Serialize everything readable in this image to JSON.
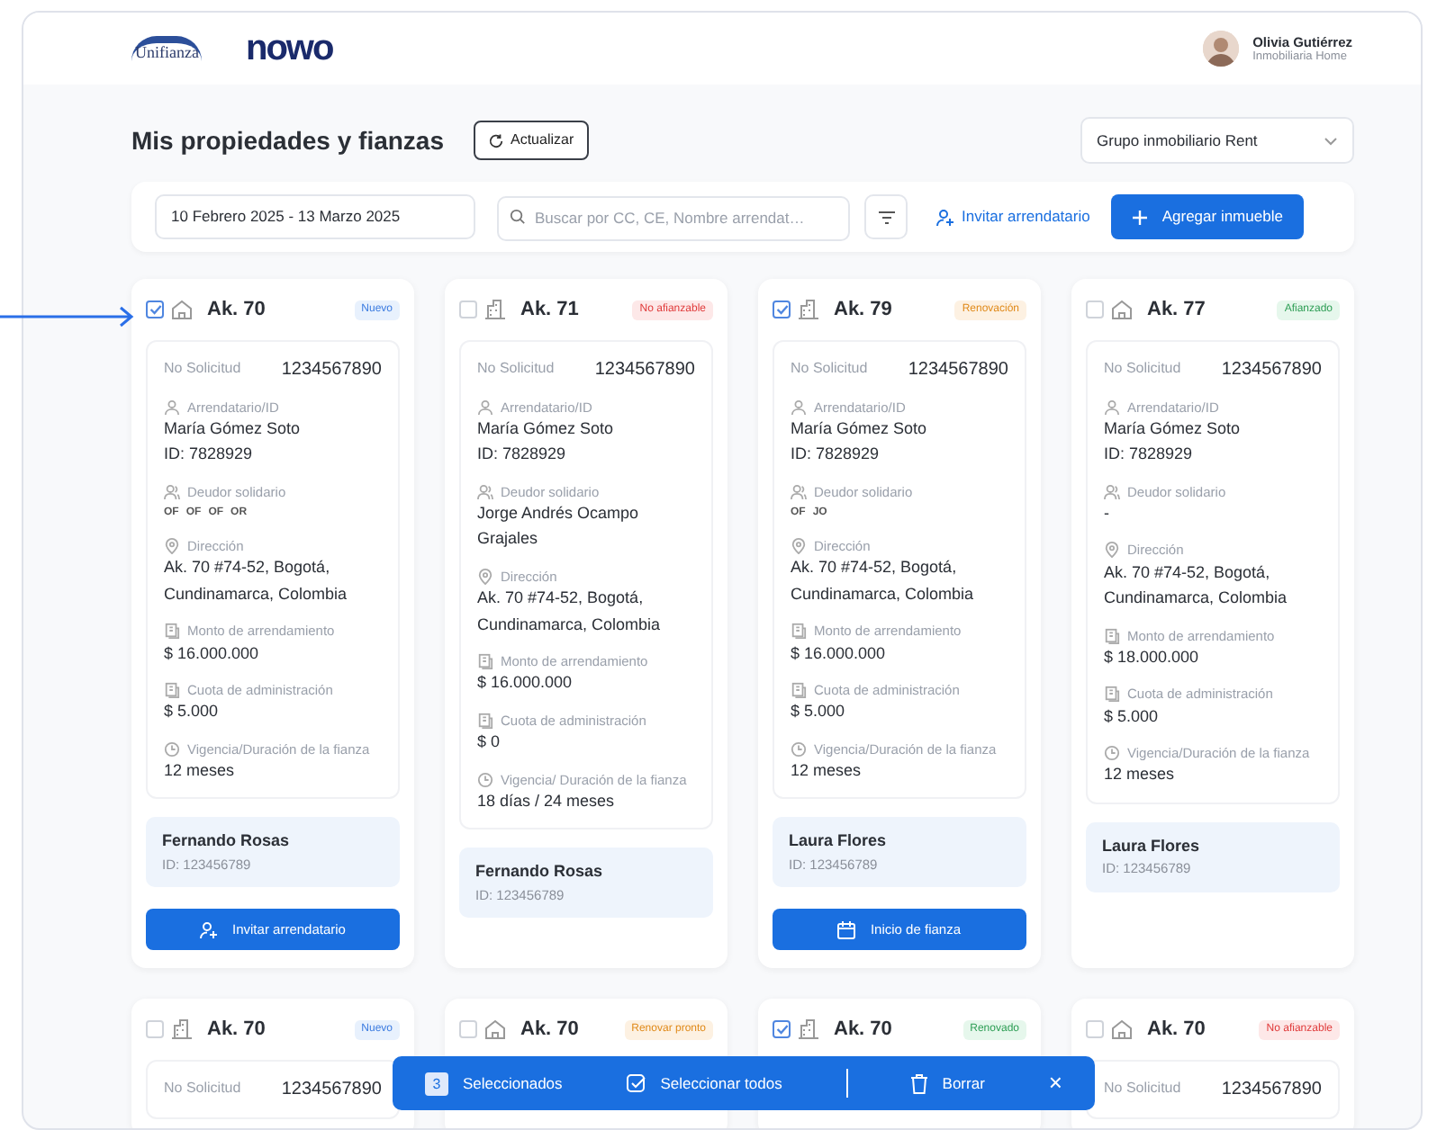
{
  "header": {
    "logos": [
      "Unifianza",
      "nowo"
    ],
    "user": {
      "name": "Olivia Gutiérrez",
      "company": "Inmobiliaria Home"
    }
  },
  "title": "Mis propiedades y fianzas",
  "refresh_button": "Actualizar",
  "group_select": {
    "value": "Grupo inmobiliario Rent"
  },
  "toolbar": {
    "date_range": "10 Febrero 2025 - 13 Marzo 2025",
    "search": {
      "placeholder": "Buscar por CC, CE, Nombre arrendat…"
    },
    "invite_link": "Invitar arrendatario",
    "add_button": "Agregar inmueble"
  },
  "cards": [
    {
      "checked": true,
      "kind": "house",
      "title": "Ak. 70",
      "status": {
        "kind": "new",
        "label": "Nuevo"
      },
      "request": {
        "label": "No Solicitud",
        "value": "1234567890"
      },
      "fields": [
        {
          "kind": "person",
          "label": "Arrendatario/ID",
          "lines": [
            "María Gómez Soto",
            "ID: 7828929"
          ]
        },
        {
          "kind": "group",
          "label": "Deudor solidario",
          "chips": [
            "OF",
            "OF",
            "OF",
            "OR"
          ]
        },
        {
          "kind": "pin",
          "label": "Dirección",
          "lines": [
            "Ak. 70 #74-52, Bogotá, Cundinamarca, Colombia"
          ]
        },
        {
          "kind": "doc",
          "label": "Monto de arrendamiento",
          "lines": [
            "$ 16.000.000"
          ]
        },
        {
          "kind": "doc",
          "label": "Cuota de administración",
          "lines": [
            "$ 5.000"
          ]
        },
        {
          "kind": "clock",
          "label": "Vigencia/Duración de la fianza",
          "lines": [
            "12 meses"
          ]
        }
      ],
      "tenant": {
        "name": "Fernando Rosas",
        "id": "ID: 123456789"
      },
      "action": {
        "kind": "invite",
        "label": "Invitar arrendatario"
      }
    },
    {
      "checked": false,
      "kind": "building",
      "title": "Ak. 71",
      "status": {
        "kind": "not_eligible",
        "label": "No afianzable"
      },
      "request": {
        "label": "No Solicitud",
        "value": "1234567890"
      },
      "fields": [
        {
          "kind": "person",
          "label": "Arrendatario/ID",
          "lines": [
            "María Gómez Soto",
            "ID: 7828929"
          ]
        },
        {
          "kind": "group",
          "label": "Deudor solidario",
          "lines": [
            "Jorge Andrés Ocampo Grajales"
          ]
        },
        {
          "kind": "pin",
          "label": "Dirección",
          "lines": [
            "Ak. 70 #74-52, Bogotá, Cundinamarca, Colombia"
          ]
        },
        {
          "kind": "doc",
          "label": "Monto de arrendamiento",
          "lines": [
            "$ 16.000.000"
          ]
        },
        {
          "kind": "doc",
          "label": "Cuota de administración",
          "lines": [
            "$ 0"
          ]
        },
        {
          "kind": "clock",
          "label": "Vigencia/ Duración de la fianza",
          "lines": [
            "18 días / 24 meses"
          ]
        }
      ],
      "tenant": {
        "name": "Fernando Rosas",
        "id": "ID: 123456789"
      }
    },
    {
      "checked": true,
      "kind": "building",
      "title": "Ak. 79",
      "status": {
        "kind": "renewal",
        "label": "Renovación"
      },
      "request": {
        "label": "No Solicitud",
        "value": "1234567890"
      },
      "fields": [
        {
          "kind": "person",
          "label": "Arrendatario/ID",
          "lines": [
            "María Gómez Soto",
            "ID: 7828929"
          ]
        },
        {
          "kind": "group",
          "label": "Deudor solidario",
          "chips": [
            "OF",
            "JO"
          ]
        },
        {
          "kind": "pin",
          "label": "Dirección",
          "lines": [
            "Ak. 70 #74-52, Bogotá, Cundinamarca, Colombia"
          ]
        },
        {
          "kind": "doc",
          "label": "Monto de arrendamiento",
          "lines": [
            "$ 16.000.000"
          ]
        },
        {
          "kind": "doc",
          "label": "Cuota de administración",
          "lines": [
            "$ 5.000"
          ]
        },
        {
          "kind": "clock",
          "label": "Vigencia/Duración de la fianza",
          "lines": [
            "12 meses"
          ]
        }
      ],
      "tenant": {
        "name": "Laura Flores",
        "id": "ID: 123456789"
      },
      "action": {
        "kind": "start",
        "label": "Inicio de fianza"
      }
    },
    {
      "checked": false,
      "kind": "house",
      "title": "Ak. 77",
      "status": {
        "kind": "bonded",
        "label": "Afianzado"
      },
      "request": {
        "label": "No Solicitud",
        "value": "1234567890"
      },
      "fields": [
        {
          "kind": "person",
          "label": "Arrendatario/ID",
          "lines": [
            "María Gómez Soto",
            "ID: 7828929"
          ]
        },
        {
          "kind": "group",
          "label": "Deudor solidario",
          "lines": [
            "-"
          ]
        },
        {
          "kind": "pin",
          "label": "Dirección",
          "lines": [
            "Ak. 70 #74-52, Bogotá, Cundinamarca, Colombia"
          ]
        },
        {
          "kind": "doc",
          "label": "Monto de arrendamiento",
          "lines": [
            "$ 18.000.000"
          ]
        },
        {
          "kind": "doc",
          "label": "Cuota de administración",
          "lines": [
            "$ 5.000"
          ]
        },
        {
          "kind": "clock",
          "label": "Vigencia/Duración de la fianza",
          "lines": [
            "12 meses"
          ]
        }
      ],
      "tenant": {
        "name": "Laura Flores",
        "id": "ID: 123456789"
      }
    },
    {
      "checked": false,
      "kind": "building",
      "title": "Ak. 70",
      "status": {
        "kind": "new",
        "label": "Nuevo"
      },
      "request": {
        "label": "No Solicitud",
        "value": "1234567890"
      }
    },
    {
      "checked": false,
      "kind": "house",
      "title": "Ak. 70",
      "status": {
        "kind": "renew_soon",
        "label": "Renovar pronto"
      }
    },
    {
      "checked": true,
      "kind": "building",
      "title": "Ak. 70",
      "status": {
        "kind": "renewed",
        "label": "Renovado"
      }
    },
    {
      "checked": false,
      "kind": "house",
      "title": "Ak. 70",
      "status": {
        "kind": "not_eligible",
        "label": "No afianzable"
      },
      "request": {
        "label": "No Solicitud",
        "value": "1234567890"
      }
    }
  ],
  "selection_bar": {
    "count": "3",
    "selected_label": "Seleccionados",
    "select_all": "Seleccionar todos",
    "delete": "Borrar",
    "close": "×"
  }
}
